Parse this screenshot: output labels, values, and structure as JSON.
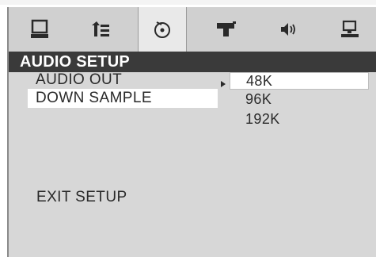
{
  "tabs": [
    {
      "icon": "monitor-icon"
    },
    {
      "icon": "settings-list-icon"
    },
    {
      "icon": "disc-audio-icon"
    },
    {
      "icon": "speaker-horn-icon"
    },
    {
      "icon": "volume-icon"
    },
    {
      "icon": "display-icon"
    }
  ],
  "title": "AUDIO SETUP",
  "menu": {
    "audio_out": "AUDIO OUT",
    "down_sample": "DOWN SAMPLE",
    "exit_setup": "EXIT SETUP"
  },
  "options": [
    "48K",
    "96K",
    "192K"
  ],
  "colors": {
    "screen_bg": "#d7d7d7",
    "title_bg": "#3a3a3a",
    "title_text": "#ffffff",
    "highlight": "#ffffff"
  }
}
